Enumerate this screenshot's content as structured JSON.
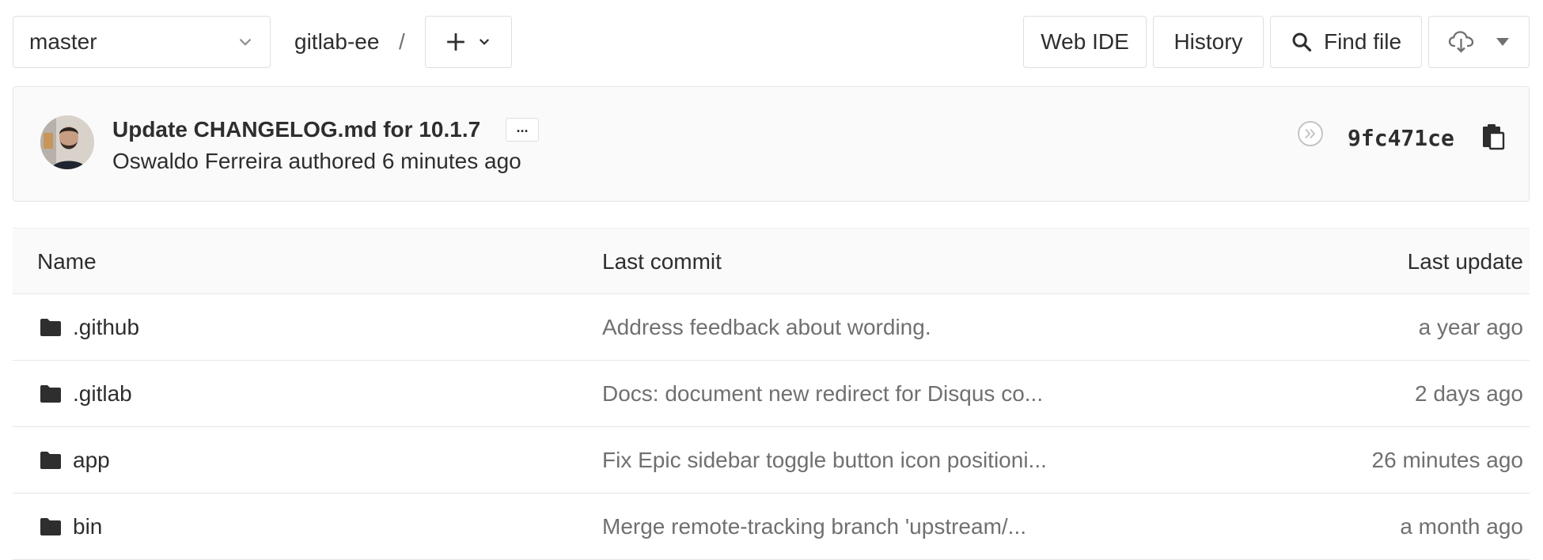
{
  "nav": {
    "branch": "master",
    "project": "gitlab-ee",
    "separator": "/",
    "web_ide_label": "Web IDE",
    "history_label": "History",
    "find_file_label": "Find file"
  },
  "commit": {
    "title": "Update CHANGELOG.md for 10.1.7",
    "ellipsis": "...",
    "meta": "Oswaldo Ferreira authored 6 minutes ago",
    "sha": "9fc471ce"
  },
  "tree": {
    "headers": {
      "name": "Name",
      "last_commit": "Last commit",
      "last_update": "Last update"
    },
    "rows": [
      {
        "name": ".github",
        "last_commit": "Address feedback about wording.",
        "last_update": "a year ago"
      },
      {
        "name": ".gitlab",
        "last_commit": "Docs: document new redirect for Disqus co...",
        "last_update": "2 days ago"
      },
      {
        "name": "app",
        "last_commit": "Fix Epic sidebar toggle button icon positioni...",
        "last_update": "26 minutes ago"
      },
      {
        "name": "bin",
        "last_commit": "Merge remote-tracking branch 'upstream/...",
        "last_update": "a month ago"
      }
    ]
  },
  "icons": {
    "branch_dropdown": "chevron-down-icon",
    "add": "plus-icon",
    "find": "search-icon",
    "download": "cloud-download-icon",
    "pipeline": "pipeline-skipped-icon",
    "copy": "clipboard-icon",
    "folder": "folder-icon"
  },
  "colors": {
    "text": "#2e2e2e",
    "muted": "#707070",
    "border": "#e5e5e5",
    "panel_bg": "#fafafa"
  }
}
